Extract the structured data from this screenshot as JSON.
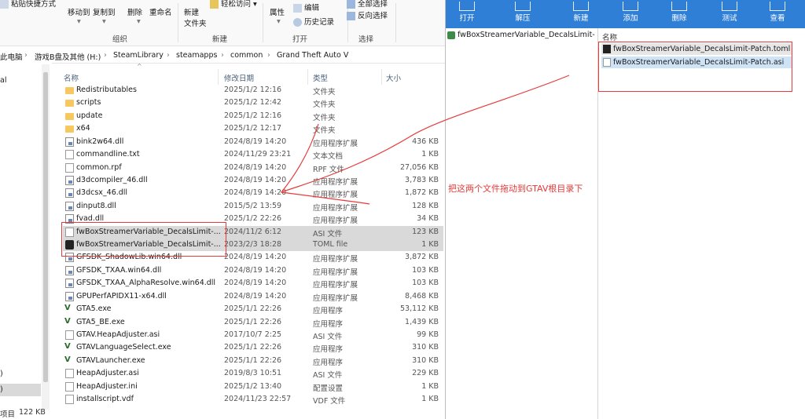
{
  "ribbon": {
    "paste_shortcut": "粘贴快捷方式",
    "move_to": "移动到",
    "copy_to": "复制到",
    "delete": "删除",
    "rename": "重命名",
    "new_folder_1": "新建",
    "new_folder_2": "文件夹",
    "easy_access": "轻松访问",
    "properties": "属性",
    "edit": "编辑",
    "history": "历史记录",
    "select_all": "全部选择",
    "invert_selection": "反向选择",
    "group_organize": "组织",
    "group_new": "新建",
    "group_open": "打开",
    "group_select": "选择"
  },
  "address": {
    "crumbs": [
      "此电脑",
      "游戏B盘及其他 (H:)",
      "SteamLibrary",
      "steamapps",
      "common",
      "Grand Theft Auto V"
    ]
  },
  "nav": {
    "item_partial": "al",
    "item_a": ")",
    "item_b": ")"
  },
  "columns": {
    "name": "名称",
    "date": "修改日期",
    "type": "类型",
    "size": "大小"
  },
  "files": [
    {
      "name": "Redistributables",
      "date": "2025/1/2 12:16",
      "type": "文件夹",
      "size": "",
      "icon": "folder-icon"
    },
    {
      "name": "scripts",
      "date": "2025/1/2 12:42",
      "type": "文件夹",
      "size": "",
      "icon": "folder-icon"
    },
    {
      "name": "update",
      "date": "2025/1/2 12:16",
      "type": "文件夹",
      "size": "",
      "icon": "folder-icon"
    },
    {
      "name": "x64",
      "date": "2025/1/2 12:17",
      "type": "文件夹",
      "size": "",
      "icon": "folder-icon"
    },
    {
      "name": "bink2w64.dll",
      "date": "2024/8/19 14:20",
      "type": "应用程序扩展",
      "size": "436 KB",
      "icon": "dll-icon"
    },
    {
      "name": "commandline.txt",
      "date": "2024/11/29 23:21",
      "type": "文本文档",
      "size": "1 KB",
      "icon": "document-icon"
    },
    {
      "name": "common.rpf",
      "date": "2024/8/19 14:20",
      "type": "RPF 文件",
      "size": "27,056 KB",
      "icon": "document-icon"
    },
    {
      "name": "d3dcompiler_46.dll",
      "date": "2024/8/19 14:20",
      "type": "应用程序扩展",
      "size": "3,783 KB",
      "icon": "dll-icon"
    },
    {
      "name": "d3dcsx_46.dll",
      "date": "2024/8/19 14:20",
      "type": "应用程序扩展",
      "size": "1,872 KB",
      "icon": "dll-icon"
    },
    {
      "name": "dinput8.dll",
      "date": "2015/5/2 13:59",
      "type": "应用程序扩展",
      "size": "128 KB",
      "icon": "dll-icon"
    },
    {
      "name": "fvad.dll",
      "date": "2025/1/2 22:26",
      "type": "应用程序扩展",
      "size": "34 KB",
      "icon": "dll-icon"
    },
    {
      "name": "fwBoxStreamerVariable_DecalsLimit-...",
      "date": "2024/11/2 6:12",
      "type": "ASI 文件",
      "size": "123 KB",
      "icon": "document-icon",
      "selected": true
    },
    {
      "name": "fwBoxStreamerVariable_DecalsLimit-...",
      "date": "2023/2/3 18:28",
      "type": "TOML file",
      "size": "1 KB",
      "icon": "toml-icon",
      "selected": true
    },
    {
      "name": "GFSDK_ShadowLib.win64.dll",
      "date": "2024/8/19 14:20",
      "type": "应用程序扩展",
      "size": "3,872 KB",
      "icon": "dll-icon"
    },
    {
      "name": "GFSDK_TXAA.win64.dll",
      "date": "2024/8/19 14:20",
      "type": "应用程序扩展",
      "size": "103 KB",
      "icon": "dll-icon"
    },
    {
      "name": "GFSDK_TXAA_AlphaResolve.win64.dll",
      "date": "2024/8/19 14:20",
      "type": "应用程序扩展",
      "size": "103 KB",
      "icon": "dll-icon"
    },
    {
      "name": "GPUPerfAPIDX11-x64.dll",
      "date": "2024/8/19 14:20",
      "type": "应用程序扩展",
      "size": "8,468 KB",
      "icon": "dll-icon"
    },
    {
      "name": "GTA5.exe",
      "date": "2025/1/1 22:26",
      "type": "应用程序",
      "size": "53,112 KB",
      "icon": "gtav-icon"
    },
    {
      "name": "GTA5_BE.exe",
      "date": "2025/1/1 22:26",
      "type": "应用程序",
      "size": "1,439 KB",
      "icon": "gtav-icon"
    },
    {
      "name": "GTAV.HeapAdjuster.asi",
      "date": "2017/10/7 2:25",
      "type": "ASI 文件",
      "size": "99 KB",
      "icon": "document-icon"
    },
    {
      "name": "GTAVLanguageSelect.exe",
      "date": "2025/1/1 22:26",
      "type": "应用程序",
      "size": "310 KB",
      "icon": "gtav-icon"
    },
    {
      "name": "GTAVLauncher.exe",
      "date": "2025/1/1 22:26",
      "type": "应用程序",
      "size": "310 KB",
      "icon": "gtav-icon"
    },
    {
      "name": "HeapAdjuster.asi",
      "date": "2019/8/3 10:51",
      "type": "ASI 文件",
      "size": "229 KB",
      "icon": "document-icon"
    },
    {
      "name": "HeapAdjuster.ini",
      "date": "2025/1/2 13:40",
      "type": "配置设置",
      "size": "1 KB",
      "icon": "document-icon"
    },
    {
      "name": "installscript.vdf",
      "date": "2024/11/23 22:57",
      "type": "VDF 文件",
      "size": "1 KB",
      "icon": "document-icon"
    }
  ],
  "status": {
    "items": "项目",
    "selected_size": "122 KB"
  },
  "archiver": {
    "toolbar": [
      "打开",
      "解压",
      "新建",
      "添加",
      "删除",
      "测试",
      "查看"
    ],
    "tree_item": "fwBoxStreamerVariable_DecalsLimit-P",
    "panel_header": "名称",
    "panel_files": [
      {
        "name": "fwBoxStreamerVariable_DecalsLimit-Patch.toml",
        "icon": "toml-icon"
      },
      {
        "name": "fwBoxStreamerVariable_DecalsLimit-Patch.asi",
        "icon": "document-icon"
      }
    ]
  },
  "annotation": {
    "text": "把这两个文件拖动到GTAV根目录下",
    "color": "#e83a3a"
  },
  "colors": {
    "accent_blue": "#2f7fd6",
    "selection_gray": "#d9d9d9",
    "selection_blue": "#cfe3f7",
    "folder_yellow": "#f6c85f"
  }
}
